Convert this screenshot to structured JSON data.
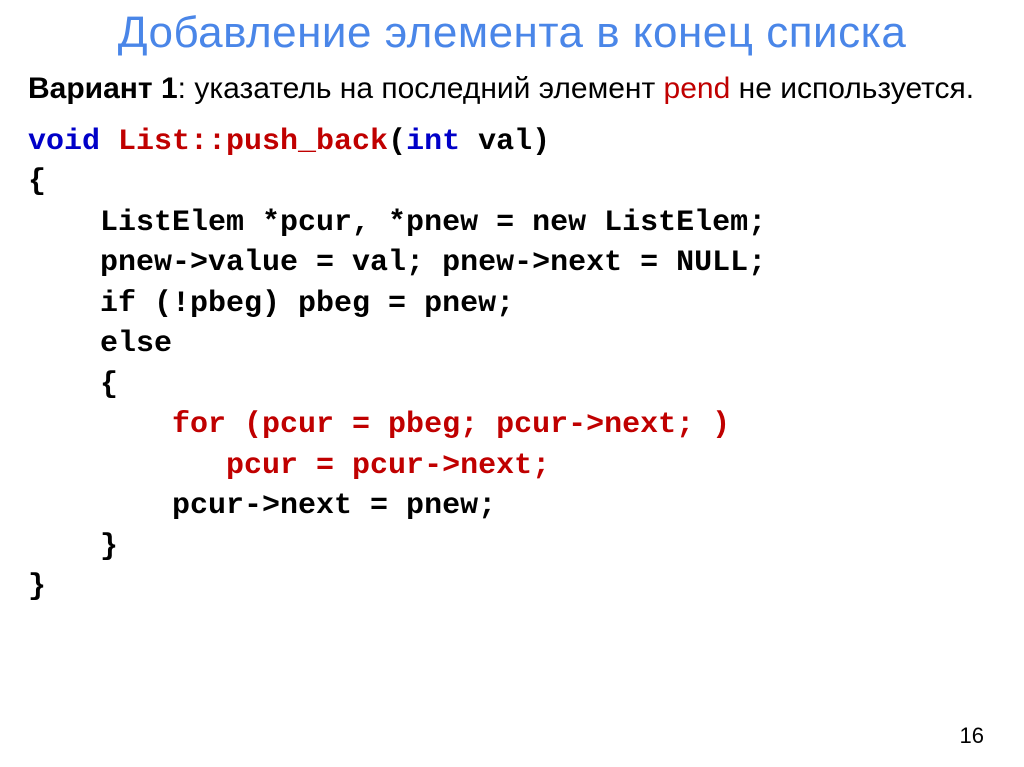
{
  "title": "Добавление элемента в конец списка",
  "desc": {
    "bold": "Вариант 1",
    "colon": ": ",
    "text1": "указатель на последний элемент ",
    "pend": "pend",
    "text2": " не используется."
  },
  "code": {
    "l1_void": "void",
    "l1_list": " List::push_back",
    "l1_int": "int",
    "l1_open": "(",
    "l1_valparen": " val)",
    "l2": "{",
    "l3": "    ListElem *pcur, *pnew = new ListElem;",
    "l4": "    pnew->value = val; pnew->next = NULL;",
    "l5": "    if (!pbeg) pbeg = pnew;",
    "l6": "    else",
    "l7": "    {",
    "l8": "        for (pcur = pbeg; pcur->next; )",
    "l9": "           pcur = pcur->next;",
    "l10": "        pcur->next = pnew;",
    "l11": "    }",
    "l12": "}"
  },
  "page_number": "16"
}
